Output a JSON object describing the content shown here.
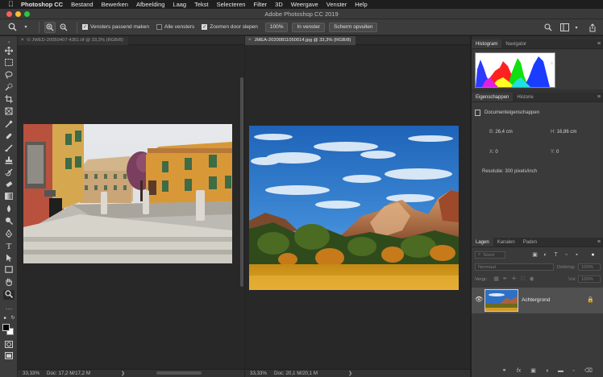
{
  "menubar": {
    "app_name": "Photoshop CC",
    "items": [
      "Bestand",
      "Bewerken",
      "Afbeelding",
      "Laag",
      "Tekst",
      "Selecteren",
      "Filter",
      "3D",
      "Weergave",
      "Venster",
      "Help"
    ]
  },
  "window": {
    "title": "Adobe Photoshop CC 2019"
  },
  "options": {
    "fit_windows_label": "Vensters passend maken",
    "all_windows_label": "Alle vensters",
    "scrubby_zoom_label": "Zoomen door slepen",
    "zoom_100_label": "100%",
    "fit_screen_label": "In venster",
    "fill_screen_label": "Scherm opvullen"
  },
  "documents": [
    {
      "tab_label": "© JWED-20050407-4351.tif @ 33,3% (RGB/8)",
      "zoom": "33,33%",
      "doc_info": "Doc: 17,2 M/17,2 M"
    },
    {
      "tab_label": "JMEA-20200811050014.jpg @ 33,3% (RGB/8)",
      "zoom": "33,33%",
      "doc_info": "Doc: 20,1 M/20,1 M"
    }
  ],
  "panels": {
    "top_tabs": [
      "Histogram",
      "Navigator"
    ],
    "properties_tabs": [
      "Eigenschappen",
      "Historie"
    ],
    "properties": {
      "section": "Documenteigenschappen",
      "width_label": "B:",
      "width_value": "26,4 cm",
      "height_label": "H:",
      "height_value": "16,86 cm",
      "x_label": "X:",
      "x_value": "0",
      "y_label": "Y:",
      "y_value": "0",
      "resolution": "Resolutie: 300 pixels/inch"
    },
    "layers_tabs": [
      "Lagen",
      "Kanalen",
      "Paden"
    ],
    "layers": {
      "kind_label": "Soort",
      "blend_mode": "Normaal",
      "opacity_label": "Dekking:",
      "opacity_value": "100%",
      "lock_label": "Vergr.:",
      "fill_label": "Vul:",
      "fill_value": "100%",
      "layer_name": "Achtergrond"
    }
  }
}
